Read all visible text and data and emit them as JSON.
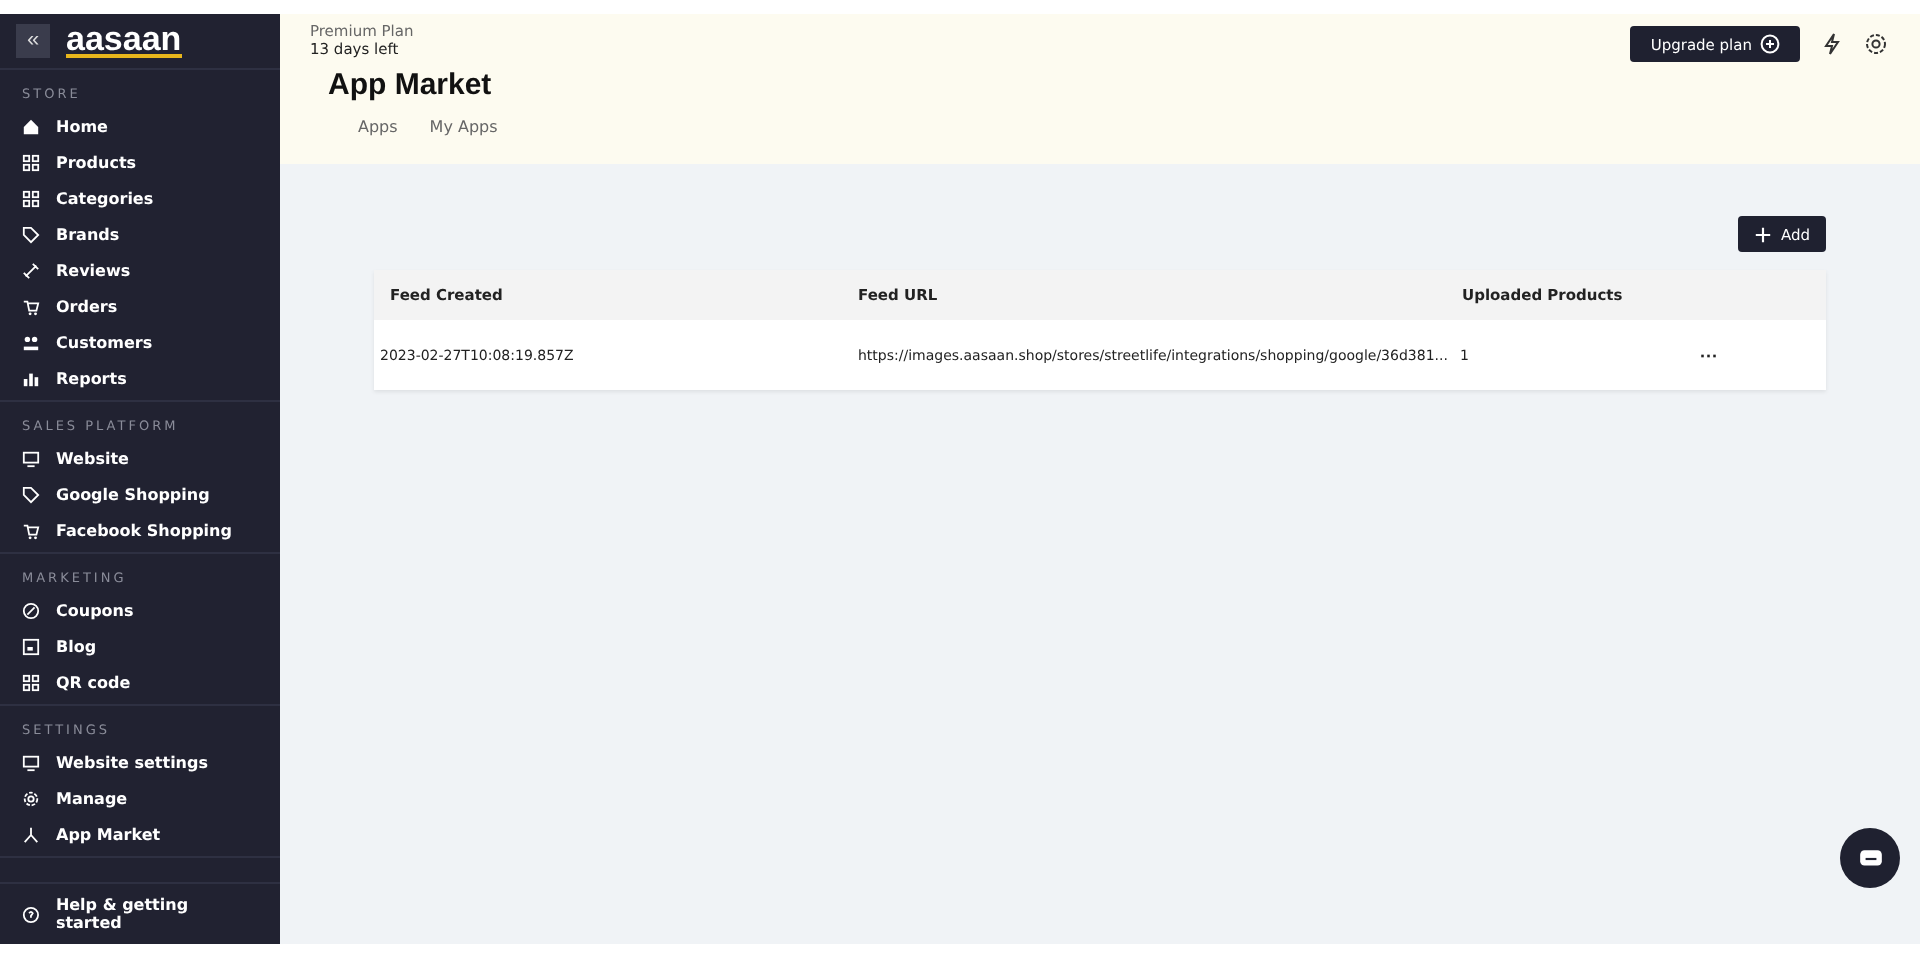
{
  "sidebar": {
    "logo": "aasaan",
    "collapse": "«",
    "sections": [
      {
        "title": "STORE",
        "items": [
          {
            "label": "Home"
          },
          {
            "label": "Products"
          },
          {
            "label": "Categories"
          },
          {
            "label": "Brands"
          },
          {
            "label": "Reviews"
          },
          {
            "label": "Orders"
          },
          {
            "label": "Customers"
          },
          {
            "label": "Reports"
          }
        ]
      },
      {
        "title": "SALES PLATFORM",
        "items": [
          {
            "label": "Website"
          },
          {
            "label": "Google Shopping"
          },
          {
            "label": "Facebook Shopping"
          }
        ]
      },
      {
        "title": "MARKETING",
        "items": [
          {
            "label": "Coupons"
          },
          {
            "label": "Blog"
          },
          {
            "label": "QR code"
          }
        ]
      },
      {
        "title": "SETTINGS",
        "items": [
          {
            "label": "Website settings"
          },
          {
            "label": "Manage"
          },
          {
            "label": "App Market"
          }
        ]
      }
    ],
    "help": "Help & getting started"
  },
  "header": {
    "plan": "Premium Plan",
    "days_left": "13 days left",
    "upgrade": "Upgrade plan",
    "title": "App Market",
    "tabs": [
      "Apps",
      "My Apps"
    ]
  },
  "add_button": "Add",
  "table": {
    "columns": [
      "Feed Created",
      "Feed URL",
      "Uploaded Products"
    ],
    "rows": [
      {
        "created": "2023-02-27T10:08:19.857Z",
        "url": "https://images.aasaan.shop/stores/streetlife/integrations/shopping/google/36d381...",
        "uploaded": "1",
        "more": "···"
      }
    ]
  }
}
